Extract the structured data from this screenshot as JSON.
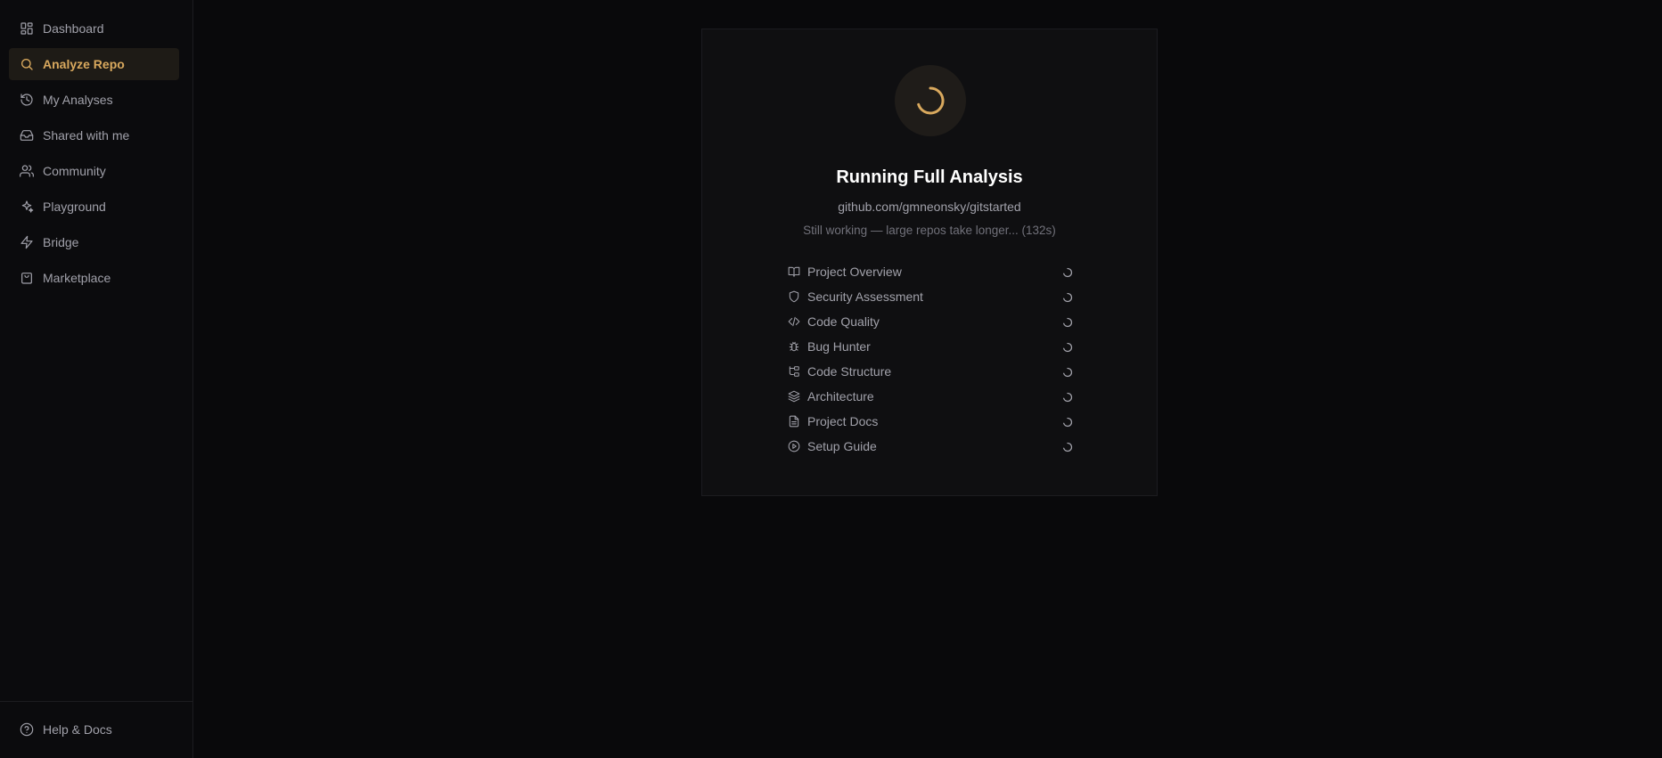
{
  "sidebar": {
    "items": [
      {
        "label": "Dashboard",
        "icon": "dashboard-icon"
      },
      {
        "label": "Analyze Repo",
        "icon": "search-icon",
        "active": true
      },
      {
        "label": "My Analyses",
        "icon": "history-icon"
      },
      {
        "label": "Shared with me",
        "icon": "inbox-icon"
      },
      {
        "label": "Community",
        "icon": "users-icon"
      },
      {
        "label": "Playground",
        "icon": "sparkles-icon"
      },
      {
        "label": "Bridge",
        "icon": "zap-icon"
      },
      {
        "label": "Marketplace",
        "icon": "shopping-bag-icon"
      }
    ],
    "footer": {
      "label": "Help & Docs",
      "icon": "help-circle-icon"
    }
  },
  "analysis": {
    "title": "Running Full Analysis",
    "repo": "github.com/gmneonsky/gitstarted",
    "status": "Still working — large repos take longer... (132s)",
    "tasks": [
      {
        "label": "Project Overview",
        "icon": "book-open-icon"
      },
      {
        "label": "Security Assessment",
        "icon": "shield-icon"
      },
      {
        "label": "Code Quality",
        "icon": "code-icon"
      },
      {
        "label": "Bug Hunter",
        "icon": "bug-icon"
      },
      {
        "label": "Code Structure",
        "icon": "git-branch-icon"
      },
      {
        "label": "Architecture",
        "icon": "layers-icon"
      },
      {
        "label": "Project Docs",
        "icon": "file-text-icon"
      },
      {
        "label": "Setup Guide",
        "icon": "play-circle-icon"
      }
    ]
  },
  "colors": {
    "background": "#09090b",
    "card": "#0f0f11",
    "accent": "#d9a95e",
    "text": "#a1a1aa",
    "title": "#ffffff"
  }
}
